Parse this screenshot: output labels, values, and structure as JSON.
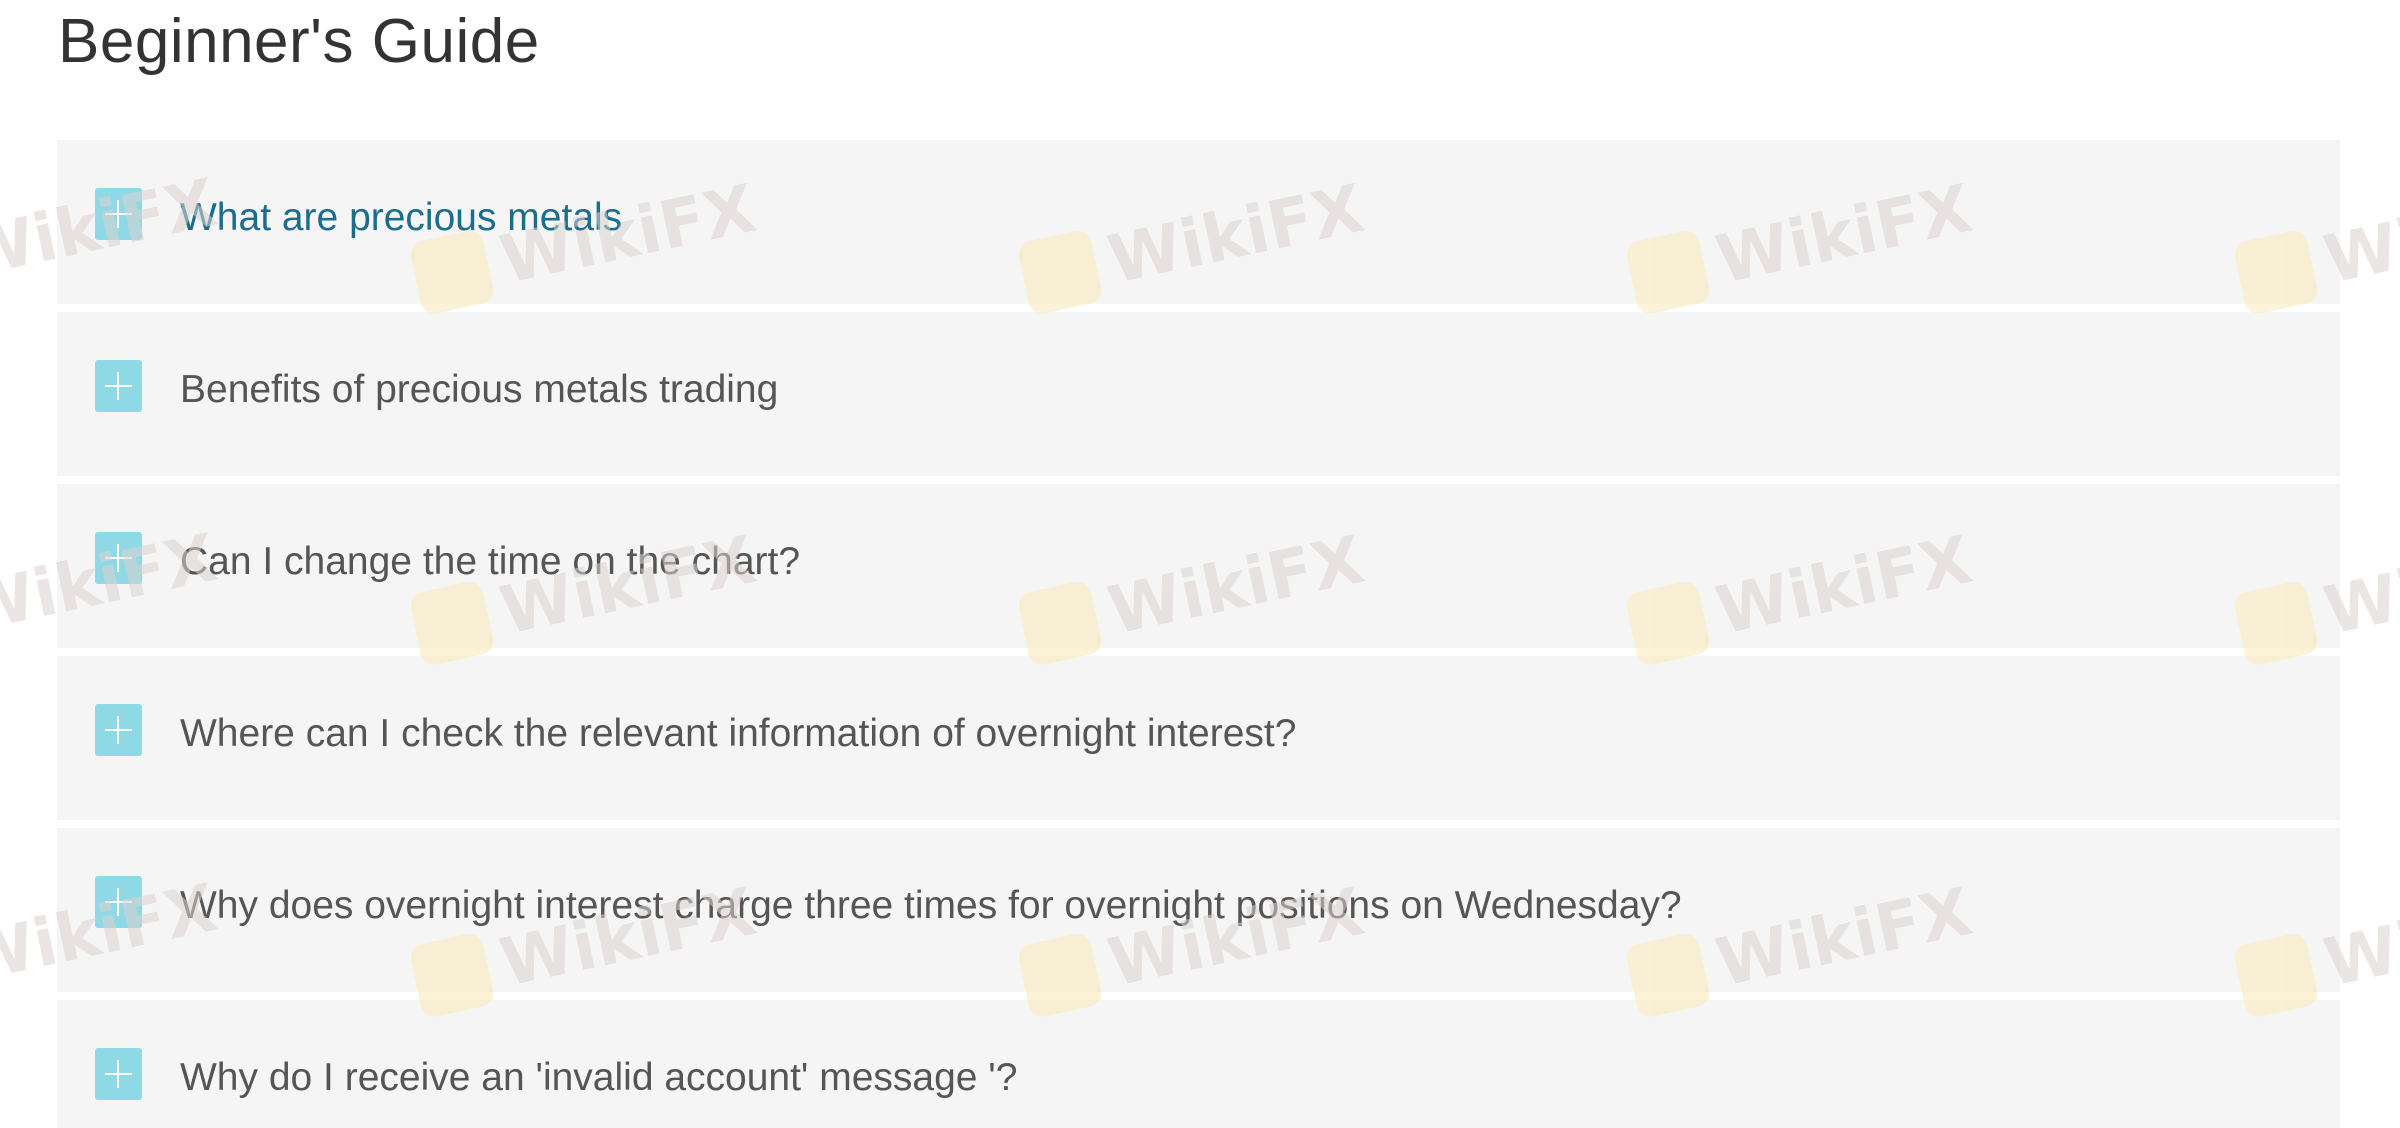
{
  "page": {
    "title": "Beginner's Guide"
  },
  "faq": {
    "items": [
      {
        "label": "What are precious metals",
        "active": true
      },
      {
        "label": "Benefits of precious metals trading",
        "active": false
      },
      {
        "label": "Can I change the time on the chart?",
        "active": false
      },
      {
        "label": "Where can I check the relevant information of overnight interest?",
        "active": false
      },
      {
        "label": "Why does overnight interest charge three times for overnight positions on Wednesday?",
        "active": false
      },
      {
        "label": "Why do I receive an 'invalid account' message '?",
        "active": false
      }
    ]
  },
  "watermark": {
    "text": "WikiFX",
    "logo_icon": "wikifx-logo-icon"
  },
  "colors": {
    "accent_plus": "#8fd8e6",
    "active_link": "#1b6d8e",
    "item_bg": "#f5f5f5",
    "text": "#555555"
  }
}
